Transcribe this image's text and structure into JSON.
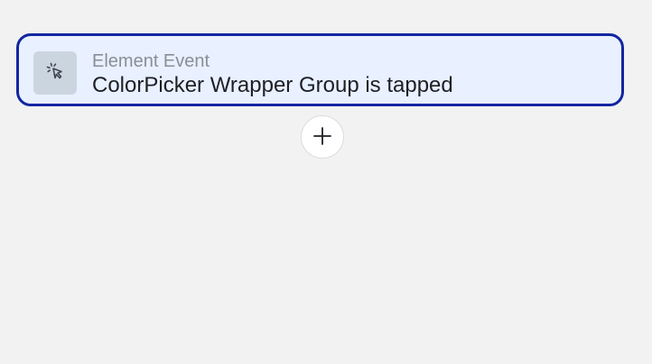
{
  "event_card": {
    "subtitle": "Element Event",
    "title": "ColorPicker Wrapper Group is tapped",
    "icon": "cursor-click-icon"
  },
  "add_button": {
    "icon": "plus-icon"
  },
  "colors": {
    "background": "#f2f2f2",
    "card_border": "#1226a0",
    "card_fill": "#e9f0ff",
    "icon_tile": "#cbd5e0"
  }
}
